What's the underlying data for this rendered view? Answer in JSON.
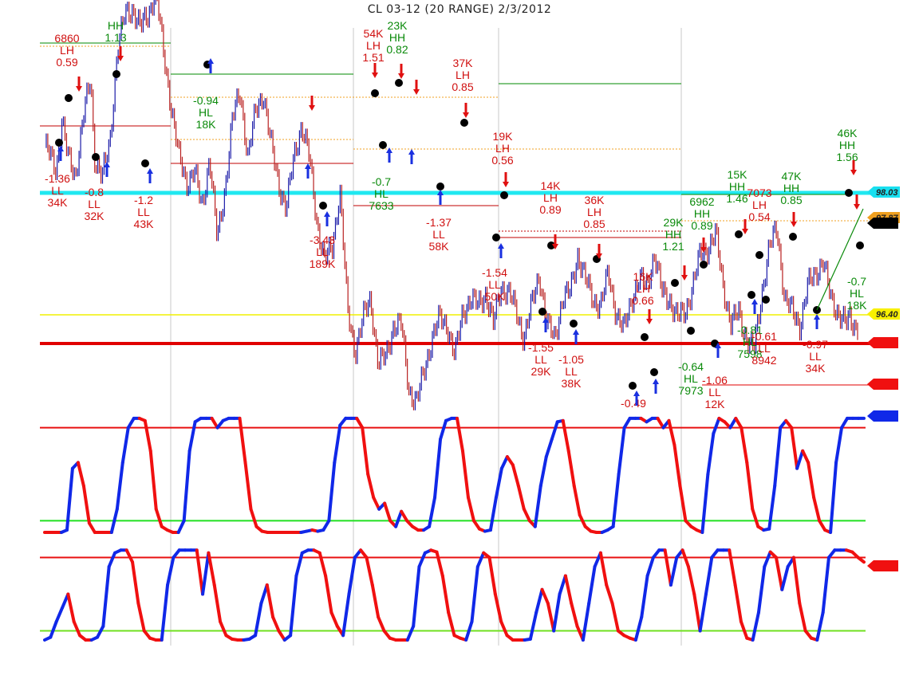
{
  "chart_data": {
    "type": "line",
    "title": "CL 03-12 (20 RANGE)  2/3/2012",
    "price_panel": {
      "ylim": [
        95.7,
        98.6
      ],
      "grid": "vertical lines only",
      "series": [
        {
          "x": [
            0,
            1.5,
            3,
            4.5,
            6,
            8,
            10,
            12,
            13,
            15,
            17,
            19,
            21,
            23,
            25,
            27,
            29,
            31,
            33,
            35,
            37,
            39,
            41,
            43,
            45,
            47,
            49,
            51,
            53,
            55,
            57,
            59,
            61,
            63,
            65,
            67,
            69,
            71,
            73,
            75,
            77,
            79,
            81,
            83,
            85,
            87,
            89,
            91,
            93,
            95,
            97,
            99,
            101,
            103,
            105,
            107,
            109,
            111,
            113,
            115,
            117,
            119,
            121,
            123,
            125,
            127,
            129,
            131,
            133,
            135,
            137,
            139,
            141,
            143,
            145,
            147,
            149,
            151,
            153,
            155,
            157,
            159,
            161,
            163,
            165,
            167,
            169,
            171,
            173,
            175,
            177,
            179,
            181,
            183,
            185,
            187,
            189,
            191,
            193,
            195,
            197,
            199,
            201,
            203,
            205,
            207,
            209,
            210,
            211,
            212
          ],
          "values": [
            97.7,
            97.6,
            97.5,
            97.9,
            97.6,
            97.45,
            97.9,
            98.2,
            97.6,
            97.45,
            97.7,
            98.45,
            98.7,
            98.75,
            98.6,
            98.7,
            98.9,
            98.4,
            98.0,
            97.6,
            97.4,
            97.5,
            97.2,
            97.6,
            96.95,
            97.35,
            97.9,
            98.1,
            97.6,
            97.95,
            98.1,
            97.7,
            97.4,
            97.2,
            97.6,
            97.85,
            97.6,
            97.1,
            96.8,
            96.9,
            97.35,
            96.4,
            96.1,
            96.35,
            96.5,
            96.0,
            96.05,
            96.3,
            96.3,
            95.8,
            95.7,
            95.95,
            96.2,
            96.35,
            96.3,
            96.05,
            96.4,
            96.5,
            96.45,
            96.55,
            96.3,
            96.6,
            96.55,
            96.4,
            96.2,
            96.45,
            96.7,
            96.3,
            96.2,
            96.5,
            96.55,
            96.85,
            96.65,
            96.5,
            96.45,
            96.7,
            96.4,
            96.25,
            96.5,
            96.65,
            96.6,
            96.85,
            96.55,
            96.5,
            96.35,
            96.4,
            96.6,
            96.85,
            96.9,
            97.0,
            96.6,
            96.3,
            96.4,
            96.2,
            96.1,
            96.55,
            96.9,
            97.05,
            96.5,
            96.4,
            96.3,
            96.6,
            96.7,
            96.8,
            96.5,
            96.4,
            96.3,
            96.35,
            96.3,
            96.3
          ]
        }
      ],
      "swing_labels": [
        {
          "lines": [
            "6860",
            "LH",
            "0.59"
          ],
          "color": "red"
        },
        {
          "lines": [
            "HH",
            "1.13"
          ],
          "color": "green"
        },
        {
          "lines": [
            "-1.36",
            "LL",
            "34K"
          ],
          "color": "red"
        },
        {
          "lines": [
            "-0.8",
            "LL",
            "32K"
          ],
          "color": "red"
        },
        {
          "lines": [
            "-1.2",
            "LL",
            "43K"
          ],
          "color": "red"
        },
        {
          "lines": [
            "-0.94",
            "HL",
            "18K"
          ],
          "color": "green"
        },
        {
          "lines": [
            "-3.43",
            "LL",
            "189K"
          ],
          "color": "red"
        },
        {
          "lines": [
            "54K",
            "LH",
            "1.51"
          ],
          "color": "red"
        },
        {
          "lines": [
            "23K",
            "HH",
            "0.82"
          ],
          "color": "green"
        },
        {
          "lines": [
            "-0.7",
            "HL",
            "7633"
          ],
          "color": "green"
        },
        {
          "lines": [
            "37K",
            "LH",
            "0.85"
          ],
          "color": "red"
        },
        {
          "lines": [
            "-1.37",
            "LL",
            "58K"
          ],
          "color": "red"
        },
        {
          "lines": [
            "19K",
            "LH",
            "0.56"
          ],
          "color": "red"
        },
        {
          "lines": [
            "-1.54",
            "LL",
            "50K"
          ],
          "color": "red"
        },
        {
          "lines": [
            "14K",
            "LH",
            "0.89"
          ],
          "color": "red"
        },
        {
          "lines": [
            "36K",
            "LH",
            "0.85"
          ],
          "color": "red"
        },
        {
          "lines": [
            "-1.55",
            "LL",
            "29K"
          ],
          "color": "red"
        },
        {
          "lines": [
            "-1.05",
            "LL",
            "38K"
          ],
          "color": "red"
        },
        {
          "lines": [
            "16K",
            "LH",
            "0.66"
          ],
          "color": "red"
        },
        {
          "lines": [
            "29K",
            "HH",
            "1.21"
          ],
          "color": "green"
        },
        {
          "lines": [
            "6962",
            "HH",
            "0.89"
          ],
          "color": "green"
        },
        {
          "lines": [
            "-0.64",
            "HL",
            "7973"
          ],
          "color": "green"
        },
        {
          "lines": [
            "-1.06",
            "LL",
            "12K"
          ],
          "color": "red"
        },
        {
          "lines": [
            "-0.49"
          ],
          "color": "red"
        },
        {
          "lines": [
            "15K",
            "HH",
            "1.46"
          ],
          "color": "green"
        },
        {
          "lines": [
            "7073",
            "LH",
            "0.54"
          ],
          "color": "red"
        },
        {
          "lines": [
            "47K",
            "HH",
            "0.85"
          ],
          "color": "green"
        },
        {
          "lines": [
            "-0.81",
            "HL",
            "7598"
          ],
          "color": "green"
        },
        {
          "lines": [
            "-0.61",
            "LL",
            "8942"
          ],
          "color": "red"
        },
        {
          "lines": [
            "-0.97",
            "LL",
            "34K"
          ],
          "color": "red"
        },
        {
          "lines": [
            "46K",
            "HH",
            "1.56"
          ],
          "color": "green"
        },
        {
          "lines": [
            "-0.7",
            "HL",
            "18K"
          ],
          "color": "green"
        }
      ],
      "price_tags": [
        {
          "label": "98.03",
          "bg": "#18e0f0"
        },
        {
          "label": "97.87",
          "bg": "#f0a020"
        },
        {
          "label": "96.40",
          "bg": "#f8f000"
        }
      ]
    },
    "oscillator_1": {
      "ylim": [
        0,
        100
      ],
      "levels": [
        90,
        10
      ],
      "values": [
        0,
        0,
        0,
        0,
        2,
        55,
        60,
        40,
        8,
        0,
        0,
        0,
        0,
        20,
        60,
        90,
        98,
        98,
        96,
        70,
        20,
        5,
        2,
        0,
        0,
        10,
        70,
        95,
        98,
        98,
        98,
        90,
        96,
        98,
        98,
        98,
        60,
        20,
        5,
        1,
        0,
        0,
        0,
        0,
        0,
        0,
        0,
        1,
        2,
        1,
        2,
        10,
        60,
        92,
        98,
        98,
        98,
        90,
        50,
        30,
        20,
        25,
        10,
        5,
        18,
        10,
        5,
        2,
        2,
        5,
        30,
        80,
        96,
        98,
        98,
        70,
        30,
        10,
        3,
        1,
        2,
        30,
        55,
        65,
        58,
        40,
        20,
        10,
        5,
        40,
        65,
        80,
        95,
        96,
        70,
        40,
        15,
        5,
        1,
        0,
        0,
        2,
        5,
        50,
        90,
        98,
        98,
        98,
        95,
        98,
        98,
        90,
        96,
        75,
        40,
        10,
        5,
        2,
        0,
        50,
        85,
        98,
        95,
        90,
        98,
        90,
        60,
        20,
        5,
        2,
        3,
        40,
        90,
        96,
        90,
        55,
        70,
        60,
        30,
        10,
        2,
        0,
        60,
        90,
        98,
        98,
        98,
        98
      ]
    },
    "oscillator_2": {
      "ylim": [
        0,
        100
      ],
      "levels": [
        90,
        10
      ],
      "values": [
        0,
        3,
        20,
        35,
        50,
        20,
        5,
        0,
        0,
        3,
        15,
        80,
        95,
        98,
        98,
        85,
        40,
        10,
        2,
        0,
        0,
        60,
        90,
        98,
        98,
        98,
        98,
        50,
        95,
        60,
        20,
        5,
        1,
        0,
        0,
        1,
        5,
        40,
        60,
        25,
        10,
        0,
        5,
        70,
        95,
        98,
        98,
        95,
        70,
        30,
        15,
        5,
        50,
        90,
        98,
        90,
        60,
        25,
        10,
        2,
        0,
        0,
        0,
        15,
        80,
        95,
        98,
        96,
        70,
        30,
        5,
        2,
        0,
        20,
        80,
        95,
        90,
        50,
        20,
        5,
        0,
        0,
        0,
        1,
        30,
        55,
        40,
        10,
        50,
        70,
        40,
        15,
        0,
        40,
        80,
        95,
        60,
        40,
        10,
        5,
        2,
        0,
        25,
        70,
        90,
        98,
        98,
        60,
        90,
        98,
        80,
        50,
        10,
        50,
        90,
        98,
        98,
        98,
        60,
        20,
        2,
        0,
        30,
        80,
        96,
        90,
        55,
        80,
        90,
        40,
        10,
        2,
        0,
        30,
        90,
        98,
        98,
        98,
        96,
        90,
        85
      ]
    },
    "x_grid_sessions": 4
  }
}
